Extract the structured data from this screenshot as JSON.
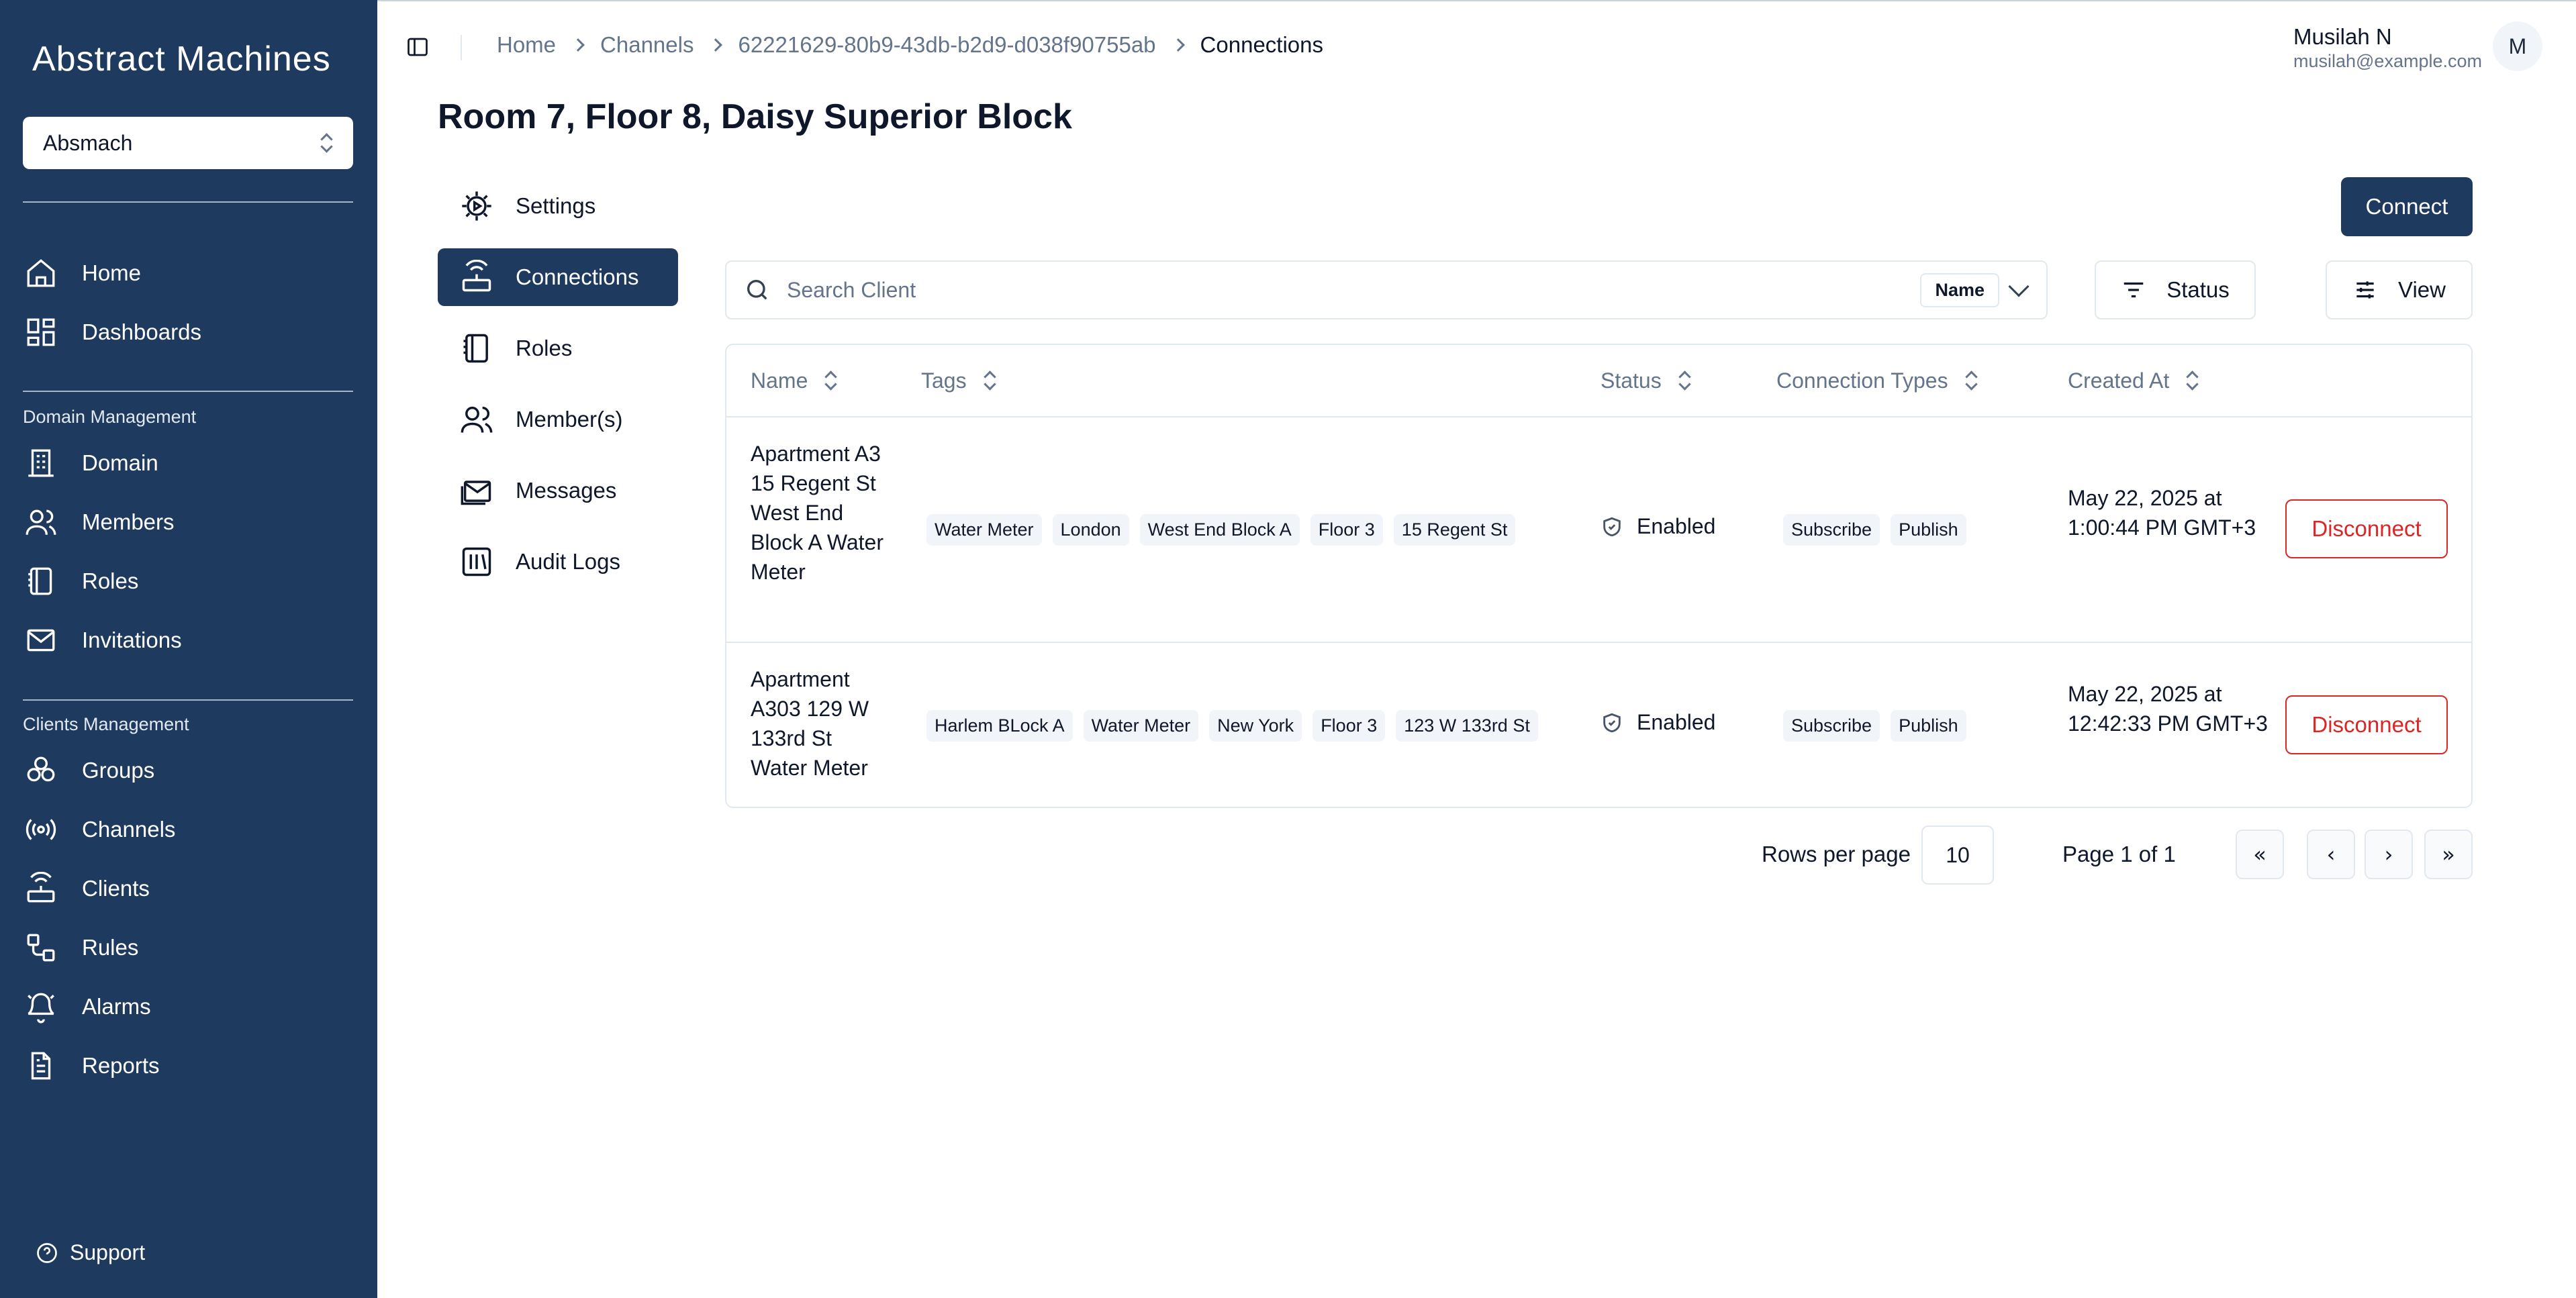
{
  "sidebar": {
    "logo": "Abstract Machines",
    "domain_select": "Absmach",
    "items_top": [
      {
        "label": "Home",
        "icon": "home-icon"
      },
      {
        "label": "Dashboards",
        "icon": "dashboards-icon"
      }
    ],
    "section_domain": "Domain Management",
    "items_domain": [
      {
        "label": "Domain",
        "icon": "building-icon"
      },
      {
        "label": "Members",
        "icon": "members-icon"
      },
      {
        "label": "Roles",
        "icon": "roles-icon"
      },
      {
        "label": "Invitations",
        "icon": "mail-icon"
      }
    ],
    "section_clients": "Clients Management",
    "items_clients": [
      {
        "label": "Groups",
        "icon": "groups-icon"
      },
      {
        "label": "Channels",
        "icon": "radio-icon"
      },
      {
        "label": "Clients",
        "icon": "router-icon"
      },
      {
        "label": "Rules",
        "icon": "rules-icon"
      },
      {
        "label": "Alarms",
        "icon": "bell-icon"
      },
      {
        "label": "Reports",
        "icon": "report-icon"
      }
    ],
    "support": "Support"
  },
  "breadcrumb": [
    "Home",
    "Channels",
    "62221629-80b9-43db-b2d9-d038f90755ab",
    "Connections"
  ],
  "user": {
    "name": "Musilah N",
    "email": "musilah@example.com",
    "initial": "M"
  },
  "page_title": "Room 7, Floor 8, Daisy Superior Block",
  "subnav": [
    {
      "label": "Settings",
      "icon": "gear-icon",
      "active": false
    },
    {
      "label": "Connections",
      "icon": "router-icon",
      "active": true
    },
    {
      "label": "Roles",
      "icon": "roles-icon",
      "active": false
    },
    {
      "label": "Member(s)",
      "icon": "members-icon",
      "active": false
    },
    {
      "label": "Messages",
      "icon": "messages-icon",
      "active": false
    },
    {
      "label": "Audit Logs",
      "icon": "audit-icon",
      "active": false
    }
  ],
  "toolbar": {
    "connect": "Connect",
    "search_placeholder": "Search Client",
    "search_field": "Name",
    "status_filter": "Status",
    "view": "View"
  },
  "table": {
    "headers": [
      "Name",
      "Tags",
      "Status",
      "Connection Types",
      "Created At"
    ],
    "rows": [
      {
        "name": "Apartment A3 15 Regent St West End Block A Water Meter",
        "tags": [
          "Water Meter",
          "London",
          "West End Block A",
          "Floor 3",
          "15 Regent St"
        ],
        "status": "Enabled",
        "types": [
          "Subscribe",
          "Publish"
        ],
        "created": "May 22, 2025 at 1:00:44 PM GMT+3",
        "action": "Disconnect"
      },
      {
        "name": "Apartment A303 129 W 133rd St Water Meter",
        "tags": [
          "Harlem BLock A",
          "Water Meter",
          "New York",
          "Floor 3",
          "123 W 133rd St"
        ],
        "status": "Enabled",
        "types": [
          "Subscribe",
          "Publish"
        ],
        "created": "May 22, 2025 at 12:42:33 PM GMT+3",
        "action": "Disconnect"
      }
    ]
  },
  "pagination": {
    "rows_label": "Rows per page",
    "rows_value": "10",
    "page_label": "Page 1 of 1",
    "first": "«",
    "prev": "‹",
    "next": "›",
    "last": "»"
  },
  "colors": {
    "sidebar": "#1f3a5f",
    "accent": "#1f3a5f",
    "danger": "#dc2626"
  }
}
